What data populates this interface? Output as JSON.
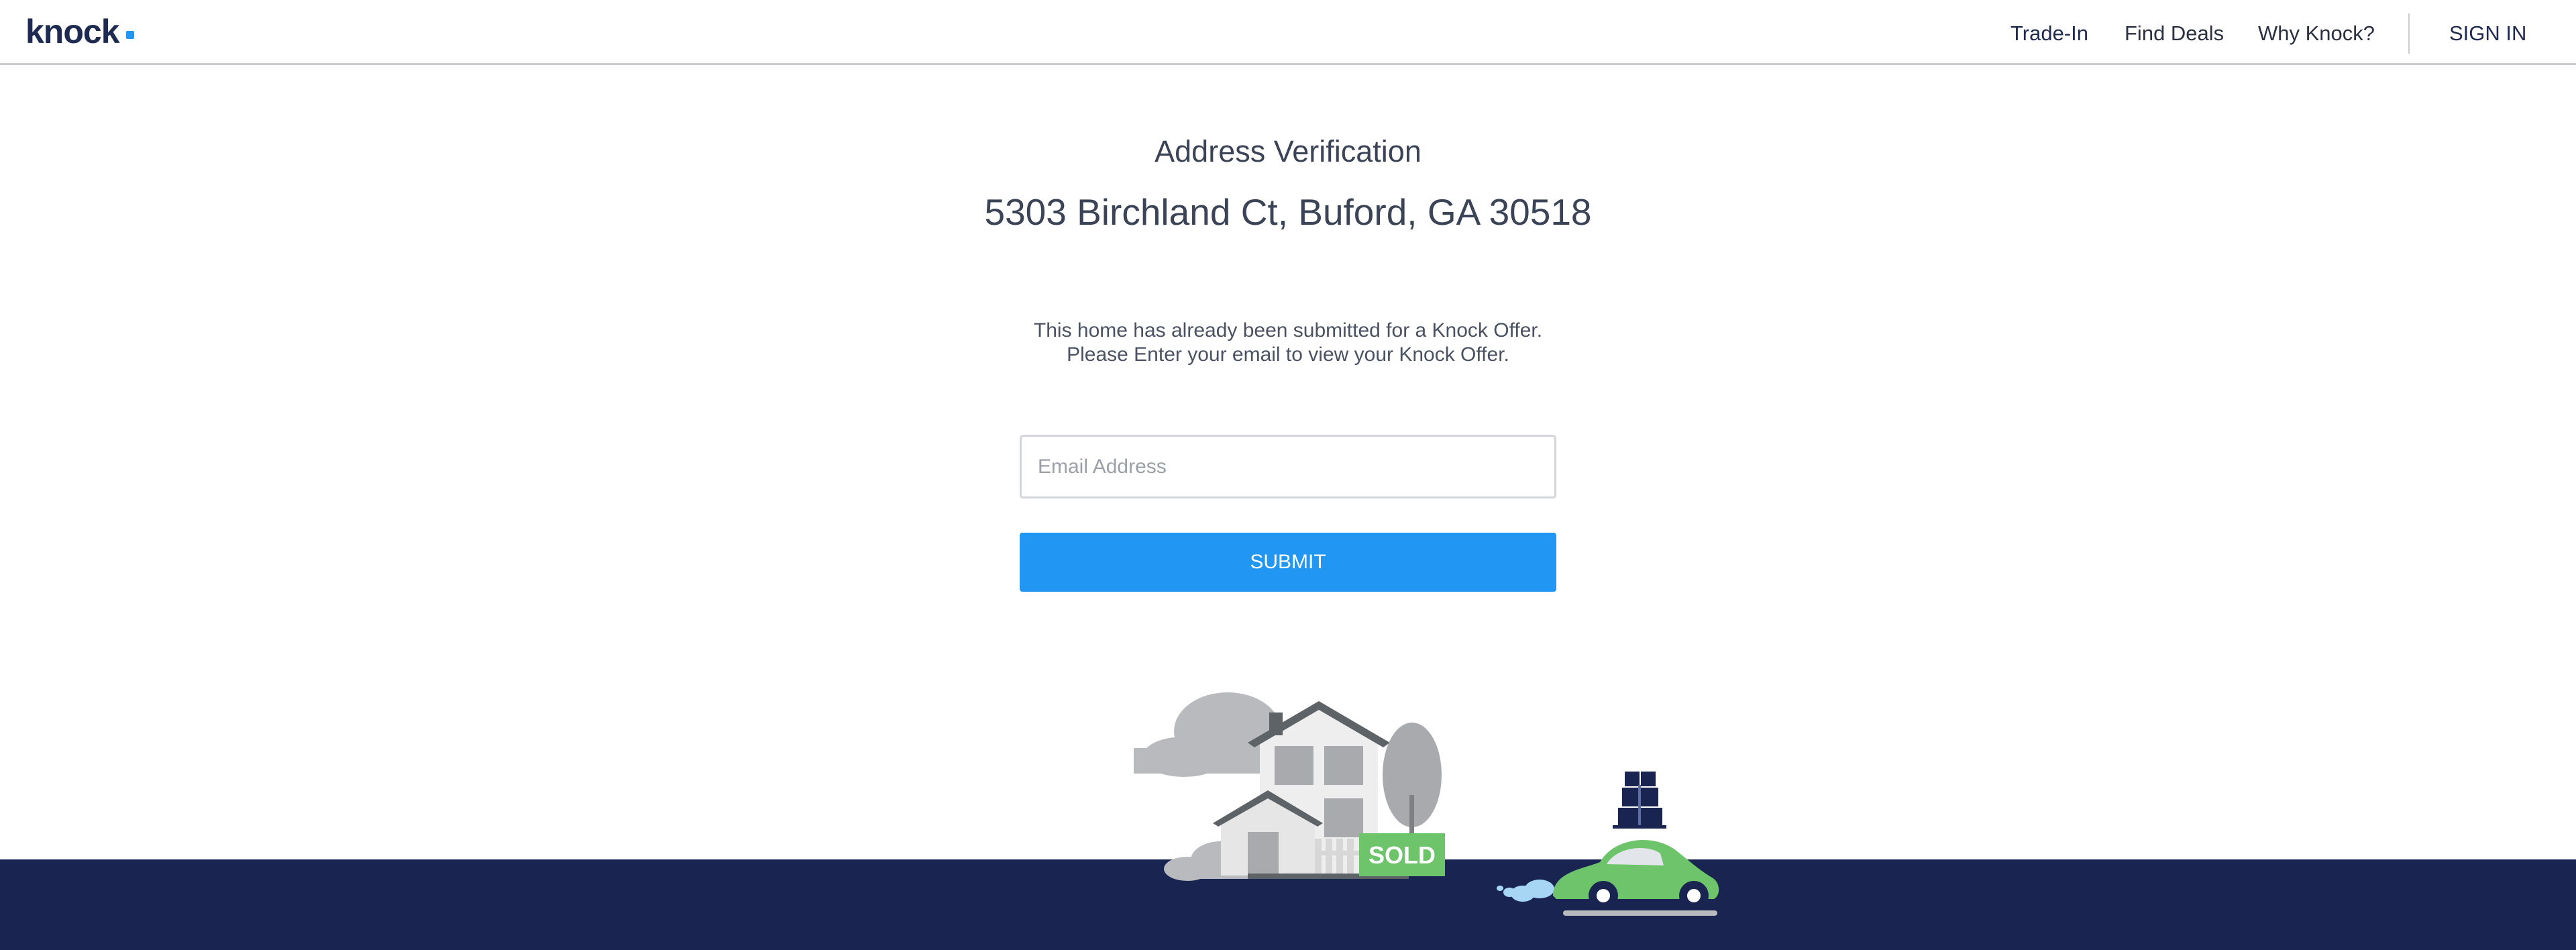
{
  "header": {
    "logo": "knock",
    "nav": [
      {
        "label": "Trade-In"
      },
      {
        "label": "Find Deals"
      },
      {
        "label": "Why Knock?"
      }
    ],
    "sign_in": "SIGN IN"
  },
  "main": {
    "title": "Address Verification",
    "address": "5303 Birchland Ct, Buford, GA 30518",
    "message_line1": "This home has already been submitted for a Knock Offer.",
    "message_line2": "Please Enter your email to view your Knock Offer.",
    "email_placeholder": "Email Address",
    "submit_label": "SUBMIT"
  },
  "illustration": {
    "sign_text": "SOLD"
  },
  "colors": {
    "brand_navy": "#192550",
    "accent_blue": "#2196f3",
    "sold_green": "#6dc46b"
  }
}
